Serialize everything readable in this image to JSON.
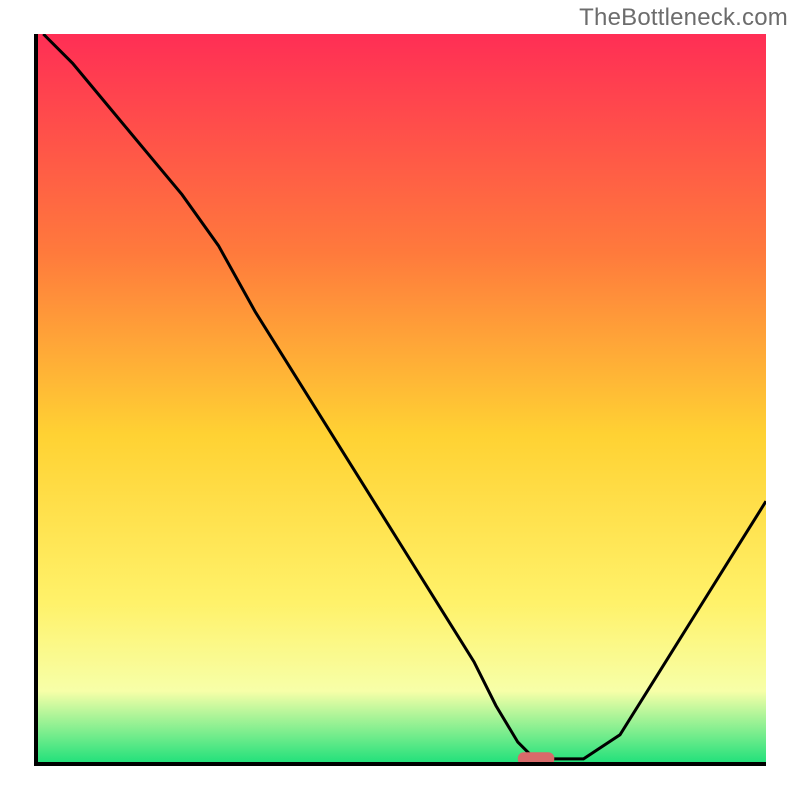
{
  "watermark": "TheBottleneck.com",
  "colors": {
    "gradient_top": "#ff2e55",
    "gradient_mid1": "#ff7a3c",
    "gradient_mid2": "#ffd233",
    "gradient_mid3": "#fff26a",
    "gradient_mid4": "#f7ffa8",
    "gradient_bottom": "#1ee07a",
    "curve": "#000000",
    "marker": "#d86a6a",
    "frame": "#000000"
  },
  "chart_data": {
    "type": "line",
    "title": "",
    "xlabel": "",
    "ylabel": "",
    "xlim": [
      0,
      100
    ],
    "ylim": [
      0,
      100
    ],
    "series": [
      {
        "name": "bottleneck-curve",
        "x": [
          1,
          5,
          10,
          15,
          20,
          25,
          30,
          35,
          40,
          45,
          50,
          55,
          60,
          63,
          66,
          68,
          70,
          75,
          80,
          85,
          90,
          95,
          100
        ],
        "y": [
          100,
          96,
          90,
          84,
          78,
          71,
          62,
          54,
          46,
          38,
          30,
          22,
          14,
          8,
          3,
          1,
          0.7,
          0.7,
          4,
          12,
          20,
          28,
          36
        ]
      }
    ],
    "annotations": [
      {
        "name": "optimal-marker",
        "x_range": [
          66,
          71
        ],
        "y": 0.8
      }
    ],
    "legend": false,
    "grid": false
  }
}
